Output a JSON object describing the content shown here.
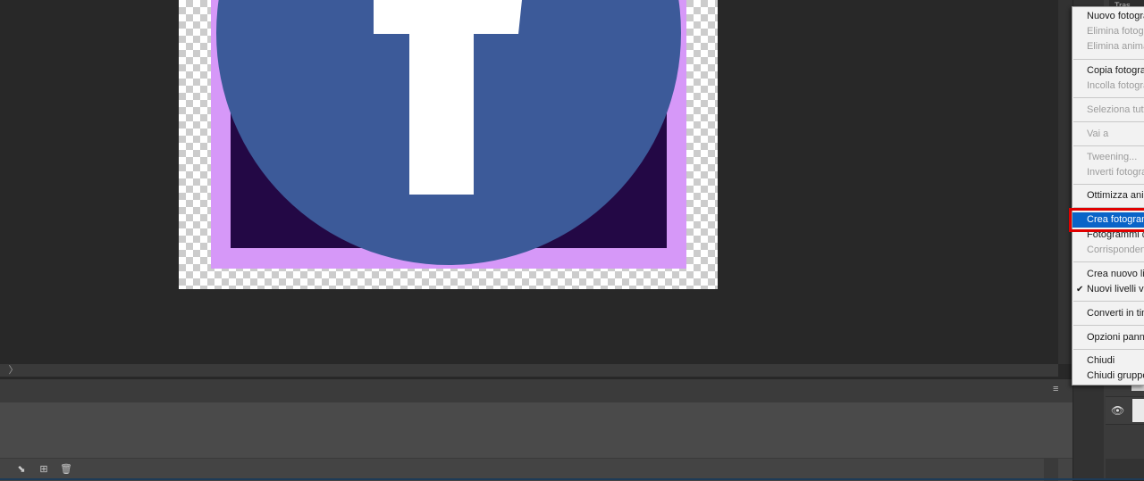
{
  "panel_tab": {
    "label": "Tras"
  },
  "menu": {
    "items": [
      {
        "label": "Nuovo fotogramma",
        "enabled": true
      },
      {
        "label": "Elimina fotogramma",
        "enabled": false
      },
      {
        "label": "Elimina animazione",
        "enabled": false
      },
      {
        "label": "Copia fotogramma",
        "enabled": true
      },
      {
        "label": "Incolla fotogramma",
        "enabled": false
      },
      {
        "label": "Seleziona tutti i fotogrammi",
        "enabled": false
      },
      {
        "label": "Vai a",
        "enabled": false
      },
      {
        "label": "Tweening...",
        "enabled": false
      },
      {
        "label": "Inverti fotogrammi",
        "enabled": false
      },
      {
        "label": "Ottimizza animazione",
        "enabled": true
      },
      {
        "label": "Crea fotogrammi da livelli",
        "enabled": true,
        "highlighted": true
      },
      {
        "label": "Fotogrammi da livelli",
        "enabled": true
      },
      {
        "label": "Corrispondenza livello",
        "enabled": false
      },
      {
        "label": "Crea nuovo livello",
        "enabled": true
      },
      {
        "label": "Nuovi livelli visibili",
        "enabled": true,
        "checked": true
      },
      {
        "label": "Converti in timeline",
        "enabled": true
      },
      {
        "label": "Opzioni pannello",
        "enabled": true
      },
      {
        "label": "Chiudi",
        "enabled": true
      },
      {
        "label": "Chiudi gruppo schede",
        "enabled": true
      }
    ],
    "check_glyph": "✔"
  },
  "icons": {
    "scroll_arrow": "〉",
    "panel_menu": "≡",
    "eye": "👁",
    "tween": "⬊",
    "new_frame": "⊞",
    "trash": "🗑"
  },
  "colors": {
    "accent": "#0a64c8",
    "highlight_box": "#e00000",
    "logo_blue": "#3c5a99",
    "frame_lilac": "#d698f8",
    "frame_dark": "#230845"
  }
}
